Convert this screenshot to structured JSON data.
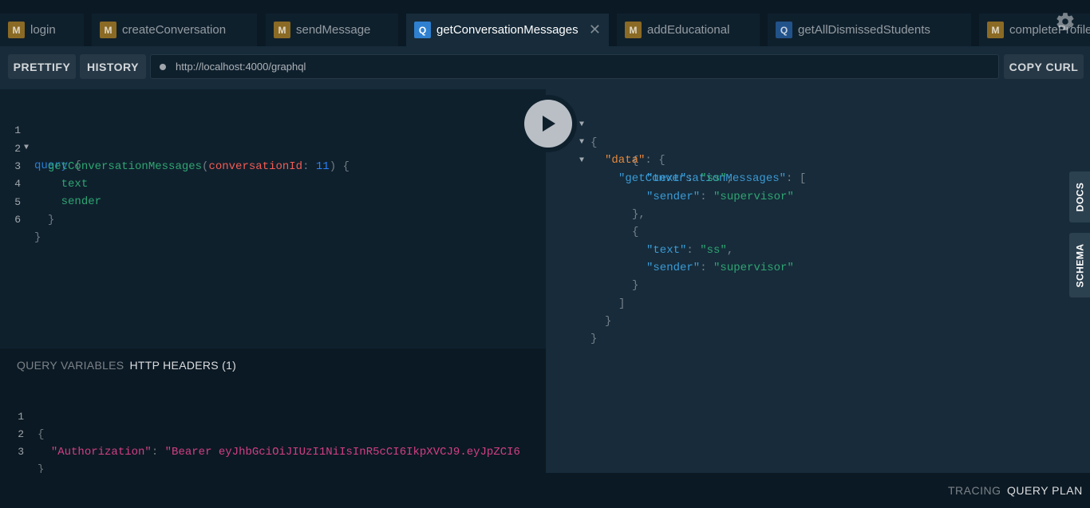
{
  "tabs": [
    {
      "type": "M",
      "label": "login",
      "active": false
    },
    {
      "type": "M",
      "label": "createConversation",
      "active": false
    },
    {
      "type": "M",
      "label": "sendMessage",
      "active": false
    },
    {
      "type": "Q",
      "label": "getConversationMessages",
      "active": true
    },
    {
      "type": "M",
      "label": "addEducational",
      "active": false
    },
    {
      "type": "Q",
      "label": "getAllDismissedStudents",
      "active": false
    },
    {
      "type": "M",
      "label": "completeProfile",
      "active": false
    }
  ],
  "toolbar": {
    "prettify": "PRETTIFY",
    "history": "HISTORY",
    "url": "http://localhost:4000/graphql",
    "copy_curl": "COPY CURL"
  },
  "editor": {
    "line_numbers": [
      "1",
      "2",
      "3",
      "4",
      "5",
      "6"
    ],
    "keyword": "query",
    "open_brace": "{",
    "operation": "getConversationMessages",
    "open_paren": "(",
    "arg_name": "conversationId",
    "colon": ":",
    "arg_value": "11",
    "close_paren_brace": ") {",
    "field1": "text",
    "field2": "sender",
    "close_inner": "}",
    "close_outer": "}"
  },
  "results": {
    "l1": "{",
    "data_key": "\"data\"",
    "data_open": ": {",
    "op_key": "\"getConversationMessages\"",
    "op_open": ": [",
    "items": [
      {
        "open": "{",
        "text_key": "\"text\"",
        "text_val": "\"ss\"",
        "sender_key": "\"sender\"",
        "sender_val": "\"supervisor\"",
        "close": "},"
      },
      {
        "open": "{",
        "text_key": "\"text\"",
        "text_val": "\"ss\"",
        "sender_key": "\"sender\"",
        "sender_val": "\"supervisor\"",
        "close": "}"
      }
    ],
    "arr_close": "]",
    "data_close": "}",
    "root_close": "}"
  },
  "side_tabs": {
    "docs": "DOCS",
    "schema": "SCHEMA"
  },
  "variables": {
    "tab_query_variables": "QUERY VARIABLES",
    "tab_http_headers": "HTTP HEADERS (1)",
    "line_numbers": [
      "1",
      "2",
      "3"
    ],
    "open": "{",
    "auth_key": "\"Authorization\"",
    "auth_val": "\"Bearer eyJhbGciOiJIUzI1NiIsInR5cCI6IkpXVCJ9.eyJpZCI6",
    "close": "}"
  },
  "footer": {
    "tracing": "TRACING",
    "query_plan": "QUERY PLAN"
  },
  "colors": {
    "accent": "#2f80d0",
    "mutation_badge": "#8a6a24",
    "background": "#0f202d"
  }
}
